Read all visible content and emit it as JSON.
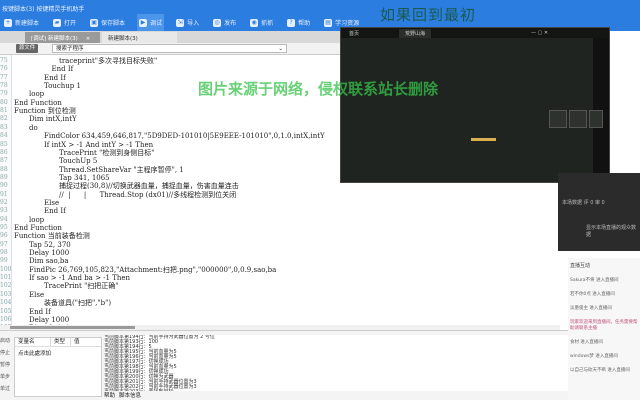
{
  "window": {
    "title": "按键脚本(3) 按键精灵手机助手"
  },
  "toolbar": {
    "items": [
      {
        "label": "新建脚本",
        "icon": "new-icon"
      },
      {
        "label": "打开",
        "icon": "folder-icon"
      },
      {
        "label": "保存脚本",
        "icon": "save-icon"
      },
      {
        "label": "调试",
        "icon": "play-icon",
        "active": true
      },
      {
        "label": "导入",
        "icon": "import-icon"
      },
      {
        "label": "发布",
        "icon": "publish-icon"
      },
      {
        "label": "抓抓",
        "icon": "camera-icon"
      },
      {
        "label": "帮助",
        "icon": "help-icon"
      },
      {
        "label": "学习资源",
        "icon": "book-icon"
      }
    ]
  },
  "tabs": [
    {
      "label": "[调试] 新建脚本(3)",
      "close": "×"
    },
    {
      "label": "新建脚本(3)"
    }
  ],
  "subbar": {
    "button": "源文件",
    "function_select": "搜索子程序"
  },
  "code": [
    {
      "n": "75",
      "indent": 6,
      "text": "traceprint\"多次寻找目标失败\""
    },
    {
      "n": "76",
      "indent": 5,
      "text": "End If"
    },
    {
      "n": "77",
      "indent": 4,
      "text": "End If"
    },
    {
      "n": "78",
      "indent": 4,
      "text": "Touchup 1"
    },
    {
      "n": "79",
      "indent": 2,
      "text": "loop"
    },
    {
      "n": "80",
      "indent": 0,
      "text": "End Function"
    },
    {
      "n": "81",
      "indent": 0,
      "text": "Function 到位检测"
    },
    {
      "n": "82",
      "indent": 2,
      "text": "Dim intX,intY"
    },
    {
      "n": "83",
      "indent": 2,
      "text": "do"
    },
    {
      "n": "84",
      "indent": 4,
      "text": "FindColor 634,459,646,817,\"5D9DED-101010|5E9EEE-101010\",0,1.0,intX,intY"
    },
    {
      "n": "85",
      "indent": 4,
      "text": "If intX > -1 And intY > -1 Then"
    },
    {
      "n": "86",
      "indent": 6,
      "text": "TracePrint \"检测到身侧目标\""
    },
    {
      "n": "87",
      "indent": 6,
      "text": "TouchUp 5"
    },
    {
      "n": "88",
      "indent": 6,
      "text": "Thread.SetShareVar \"主程序暂停\", 1"
    },
    {
      "n": "89",
      "indent": 6,
      "text": "Tap 341, 1065"
    },
    {
      "n": "90",
      "indent": 6,
      "text": "捕捉过程(30,8)//切换武器血量，捕捉血量，伤害血量连击"
    },
    {
      "n": "91",
      "indent": 6,
      "text": "//  |      |      Thread.Stop (dx01)//多线程检测到位关闭"
    },
    {
      "n": "92",
      "indent": 4,
      "text": "Else"
    },
    {
      "n": "93",
      "indent": 4,
      "text": "End If"
    },
    {
      "n": "94",
      "indent": 2,
      "text": "loop"
    },
    {
      "n": "95",
      "indent": 0,
      "text": "End Function"
    },
    {
      "n": "96",
      "indent": 0,
      "text": "Function 当前装备检测"
    },
    {
      "n": "97",
      "indent": 2,
      "text": "Tap 52, 370"
    },
    {
      "n": "98",
      "indent": 2,
      "text": "Delay 1000"
    },
    {
      "n": "99",
      "indent": 2,
      "text": "Dim sao,ba"
    },
    {
      "n": "100",
      "indent": 2,
      "text": "FindPic 26,769,105,823,\"Attachment:扫把.png\",\"000000\",0,0.9,sao,ba"
    },
    {
      "n": "101",
      "indent": 2,
      "text": "If sao > -1 And ba > -1 Then"
    },
    {
      "n": "102",
      "indent": 4,
      "text": "TracePrint \"扫把正确\""
    },
    {
      "n": "103",
      "indent": 2,
      "text": "Else"
    },
    {
      "n": "104",
      "indent": 4,
      "text": "装备道具(\"扫把\",\"b\")"
    },
    {
      "n": "105",
      "indent": 2,
      "text": "End If"
    },
    {
      "n": "106",
      "indent": 2,
      "text": "Delay 1000"
    },
    {
      "n": "107",
      "indent": 2,
      "text": "Dim chui,zi"
    }
  ],
  "bottom": {
    "left_labels": [
      "启动",
      "停止",
      "暂停",
      "单步",
      "单过"
    ],
    "vars_headers": [
      "变量名",
      "类型",
      "值"
    ],
    "vars_add": "点击此處添加",
    "log": [
      "当前脚本第194行：当前手持为武器位置为 2 号位",
      "当前脚本第193行：100",
      "当前脚本第194行：5",
      "当前脚本第195行：当前血量为5",
      "当前脚本第196行：当前血量为5",
      "当前脚本第197行：切换成功",
      "当前脚本第198行：当前血量为5",
      "当前脚本第199行：切换成功",
      "当前脚本第200行：切换为武器",
      "当前脚本第201行：当前手持武器位置为3",
      "当前脚本第202行：当前手持武器位置为3",
      "当前脚本第203行：未找到目标",
      "当前脚本第204行：当前血量为5 检测到"
    ],
    "log_tabs": [
      "帮助",
      "脚本信息"
    ]
  },
  "game": {
    "tabs": [
      "首页",
      "荒野山海"
    ]
  },
  "dark_panel": {
    "title": "本场数据",
    "stats": "评 0   审 0",
    "note": "显示本场直播的观众数据"
  },
  "chat": {
    "title": "直播互动",
    "items": [
      "Sakura不将 进入直播间",
      "若不你0点 进入直播间",
      "淡墨俊主 进入直播间",
      "玩家欢迎来到直播间，任务需要帮助请联系主播",
      "食材 进入直播间",
      "windows梦 进入直播间",
      "以自己与砍天不断 进入直播间"
    ],
    "notice_color": "#c0507a"
  },
  "watermarks": {
    "top": "如果回到最初",
    "center": "图片来源于网络，侵权联系站长删除"
  },
  "colors": {
    "accent": "#2b7de0",
    "log_highlight": "#2c76c8"
  }
}
